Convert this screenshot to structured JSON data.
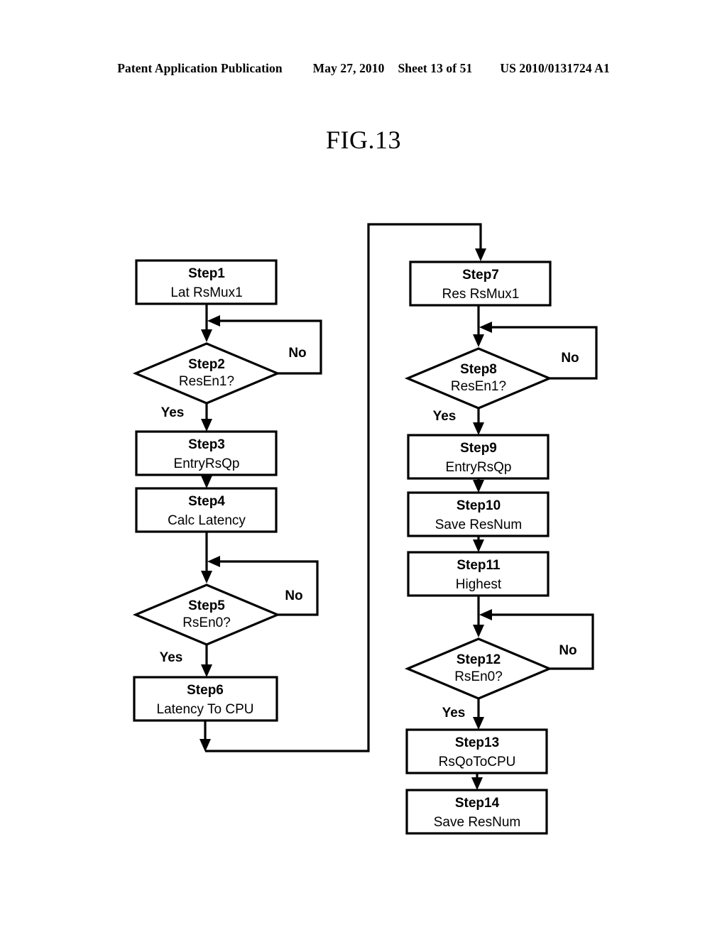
{
  "header": {
    "publication": "Patent Application Publication",
    "date": "May 27, 2010",
    "sheet": "Sheet 13 of 51",
    "patent_number": "US 2010/0131724 A1"
  },
  "figure": {
    "title": "FIG.13"
  },
  "flowchart": {
    "edge_labels": {
      "yes": "Yes",
      "no": "No"
    },
    "nodes": [
      {
        "id": "step1",
        "shape": "process",
        "title": "Step1",
        "sub": "Lat RsMux1"
      },
      {
        "id": "step2",
        "shape": "decision",
        "title": "Step2",
        "sub": "ResEn1?"
      },
      {
        "id": "step3",
        "shape": "process",
        "title": "Step3",
        "sub": "EntryRsQp"
      },
      {
        "id": "step4",
        "shape": "process",
        "title": "Step4",
        "sub": "Calc Latency"
      },
      {
        "id": "step5",
        "shape": "decision",
        "title": "Step5",
        "sub": "RsEn0?"
      },
      {
        "id": "step6",
        "shape": "process",
        "title": "Step6",
        "sub": "Latency To CPU"
      },
      {
        "id": "step7",
        "shape": "process",
        "title": "Step7",
        "sub": "Res RsMux1"
      },
      {
        "id": "step8",
        "shape": "decision",
        "title": "Step8",
        "sub": "ResEn1?"
      },
      {
        "id": "step9",
        "shape": "process",
        "title": "Step9",
        "sub": "EntryRsQp"
      },
      {
        "id": "step10",
        "shape": "process",
        "title": "Step10",
        "sub": "Save ResNum"
      },
      {
        "id": "step11",
        "shape": "process",
        "title": "Step11",
        "sub": "Highest"
      },
      {
        "id": "step12",
        "shape": "decision",
        "title": "Step12",
        "sub": "RsEn0?"
      },
      {
        "id": "step13",
        "shape": "process",
        "title": "Step13",
        "sub": "RsQoToCPU"
      },
      {
        "id": "step14",
        "shape": "process",
        "title": "Step14",
        "sub": "Save ResNum"
      }
    ],
    "branch_labels": [
      {
        "id": "step2-no",
        "text": "No"
      },
      {
        "id": "step2-yes",
        "text": "Yes"
      },
      {
        "id": "step5-no",
        "text": "No"
      },
      {
        "id": "step5-yes",
        "text": "Yes"
      },
      {
        "id": "step8-no",
        "text": "No"
      },
      {
        "id": "step8-yes",
        "text": "Yes"
      },
      {
        "id": "step12-no",
        "text": "No"
      },
      {
        "id": "step12-yes",
        "text": "Yes"
      }
    ]
  },
  "colors": {
    "ink": "#000000",
    "paper": "#ffffff"
  }
}
